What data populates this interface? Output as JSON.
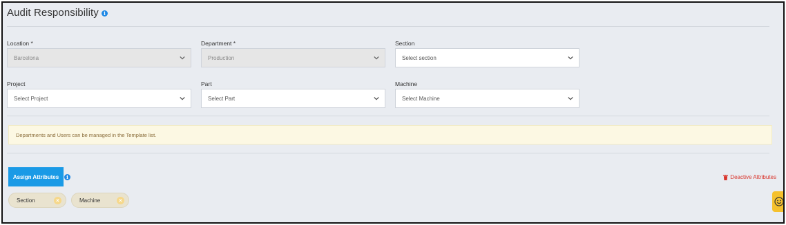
{
  "page": {
    "title": "Audit Responsibility"
  },
  "fields": {
    "location": {
      "label": "Location *",
      "value": "Barcelona"
    },
    "department": {
      "label": "Department *",
      "value": "Production"
    },
    "section": {
      "label": "Section",
      "value": "Select section"
    },
    "project": {
      "label": "Project",
      "value": "Select Project"
    },
    "part": {
      "label": "Part",
      "value": "Select Part"
    },
    "machine": {
      "label": "Machine",
      "value": "Select Machine"
    }
  },
  "notice": {
    "text": "Departments and Users can be managed in the Template list."
  },
  "attributes": {
    "assign_label": "Assign Attributes",
    "deactive_label": "Deactive Attributes",
    "chips": [
      {
        "label": "Section"
      },
      {
        "label": "Machine"
      }
    ]
  },
  "icons": {
    "info": "info-icon",
    "chevron": "chevron-down-icon",
    "trash": "trash-icon",
    "remove": "close-circle-icon",
    "feedback": "smiley-icon"
  },
  "colors": {
    "background": "#e9ecf1",
    "primary": "#1a9ae6",
    "danger": "#d9342b",
    "notice_bg": "#fcf8e3",
    "chip_bg": "#e9e3cf",
    "feedback": "#f5c12e"
  }
}
